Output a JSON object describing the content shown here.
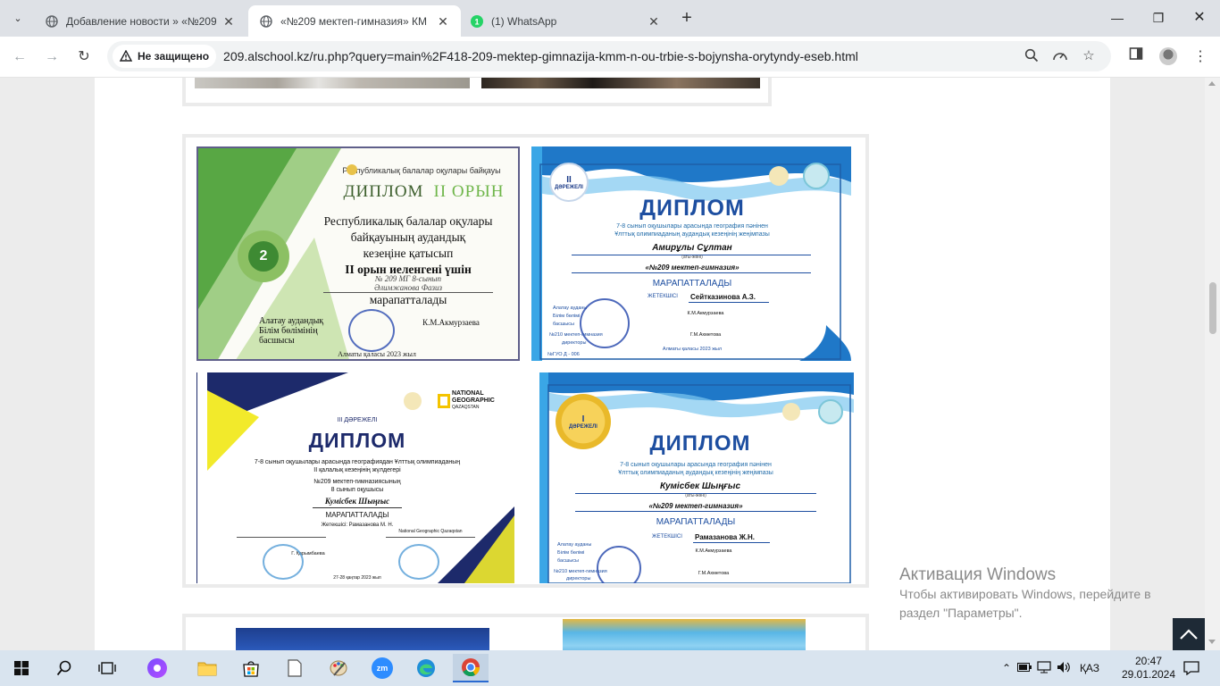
{
  "browser": {
    "tabs": [
      {
        "title": "Добавление новости » «№209",
        "active": false
      },
      {
        "title": "«№209 мектеп-гимназия» КМ",
        "active": true
      },
      {
        "title": "(1) WhatsApp",
        "active": false
      }
    ],
    "security_label": "Не защищено",
    "url": "209.alschool.kz/ru.php?query=main%2F418-209-mektep-gimnazija-kmm-n-ou-trbie-s-bojynsha-orytyndy-eseb.html"
  },
  "diplomas": {
    "d1": {
      "org": "Республикалық балалар оқулары байқауы",
      "heading": "ДИПЛОМ",
      "place": "II ОРЫН",
      "badge": "2",
      "line1": "Республикалық балалар оқулары",
      "line2": "байқауының аудандық",
      "line3": "кезеңіне қатысып",
      "line4": "II орын иеленгені үшін",
      "line5": "№ 209 МГ   8-сынып",
      "line6": "Әлимжанова  Фазиз",
      "award": "марапатталады",
      "sign_left1": "Алатау аудандық",
      "sign_left2": "Білім бөлімінің",
      "sign_left3": "басшысы",
      "signer": "К.М.Акмурзаева",
      "footer": "Алматы қаласы 2023 жыл"
    },
    "d2": {
      "degree_num": "II",
      "degree_word": "ДӘРЕЖЕЛІ",
      "heading": "ДИПЛОМ",
      "desc1": "7-8 сынып оқушылары арасында география пәнінен",
      "desc2": "Ұлттық олимпиаданың аудандық кезеңінің жеңімпазы",
      "name": "Амирұлы Сұлтан",
      "name_caption": "(аты-жөні)",
      "school": "«№209 мектеп-гимназия»",
      "award": "МАРАПАТТАЛАДЫ",
      "mentor_label": "ЖЕТЕКШІСІ",
      "mentor": "Сейтказинова А.З.",
      "sign_a1": "Алатау ауданы",
      "sign_a2": "Білім бөлімі",
      "sign_a3": "басшысы",
      "sign_b": "№210 мектеп-гимназия",
      "sign_c": "директоры",
      "signer1": "К.М.Акмурзаева",
      "signer2": "Г.М.Ахметова",
      "footer": "Алматы қаласы 2023 жыл",
      "reg": "№ГУО Д - 006"
    },
    "d3": {
      "degree": "III ДӘРЕЖЕЛІ",
      "heading": "ДИПЛОМ",
      "ng1": "NATIONAL",
      "ng2": "GEOGRAPHIC",
      "ng3": "QAZAQSTAN",
      "desc1": "7-8 сынып оқушылары арасында географиядан Ұлттық олимпиаданың",
      "desc2": "II қалалық кезеңінің жүлдегері",
      "school": "№209 мектеп-гимназиясының",
      "grade": "8 сынып оқушысы",
      "name": "Кумісбек Шыңғыс",
      "award": "МАРАПАТТАЛАДЫ",
      "mentor": "Жетекшісі: Рамазанова М. Н.",
      "sign_left": "Г. Қарымбаева",
      "sign_right": "National Geographic Qazaqstan",
      "footer": "27-28 қаңтар 2023 жыл"
    },
    "d4": {
      "degree_num": "I",
      "degree_word": "ДӘРЕЖЕЛІ",
      "heading": "ДИПЛОМ",
      "desc1": "7-8 сынып оқушылары арасында география пәнінен",
      "desc2": "Ұлттық олимпиаданың аудандық кезеңінің жеңімпазы",
      "name": "Кумісбек Шыңғыс",
      "name_caption": "(аты-жөні)",
      "school": "«№209 мектеп-гимназия»",
      "award": "МАРАПАТТАЛАДЫ",
      "mentor_label": "ЖЕТЕКШІСІ",
      "mentor": "Рамазанова Ж.Н.",
      "sign_a1": "Алатау ауданы",
      "sign_a2": "Білім бөлімі",
      "sign_a3": "басшысы",
      "sign_b": "№210 мектеп-гимназия",
      "sign_c": "директоры",
      "signer1": "К.М.Акмурзаева",
      "signer2": "Г.М.Ахметова"
    }
  },
  "watermark": {
    "title": "Активация Windows",
    "line1": "Чтобы активировать Windows, перейдите в",
    "line2": "раздел \"Параметры\"."
  },
  "taskbar": {
    "language": "ҚАЗ",
    "time": "20:47",
    "date": "29.01.2024"
  }
}
